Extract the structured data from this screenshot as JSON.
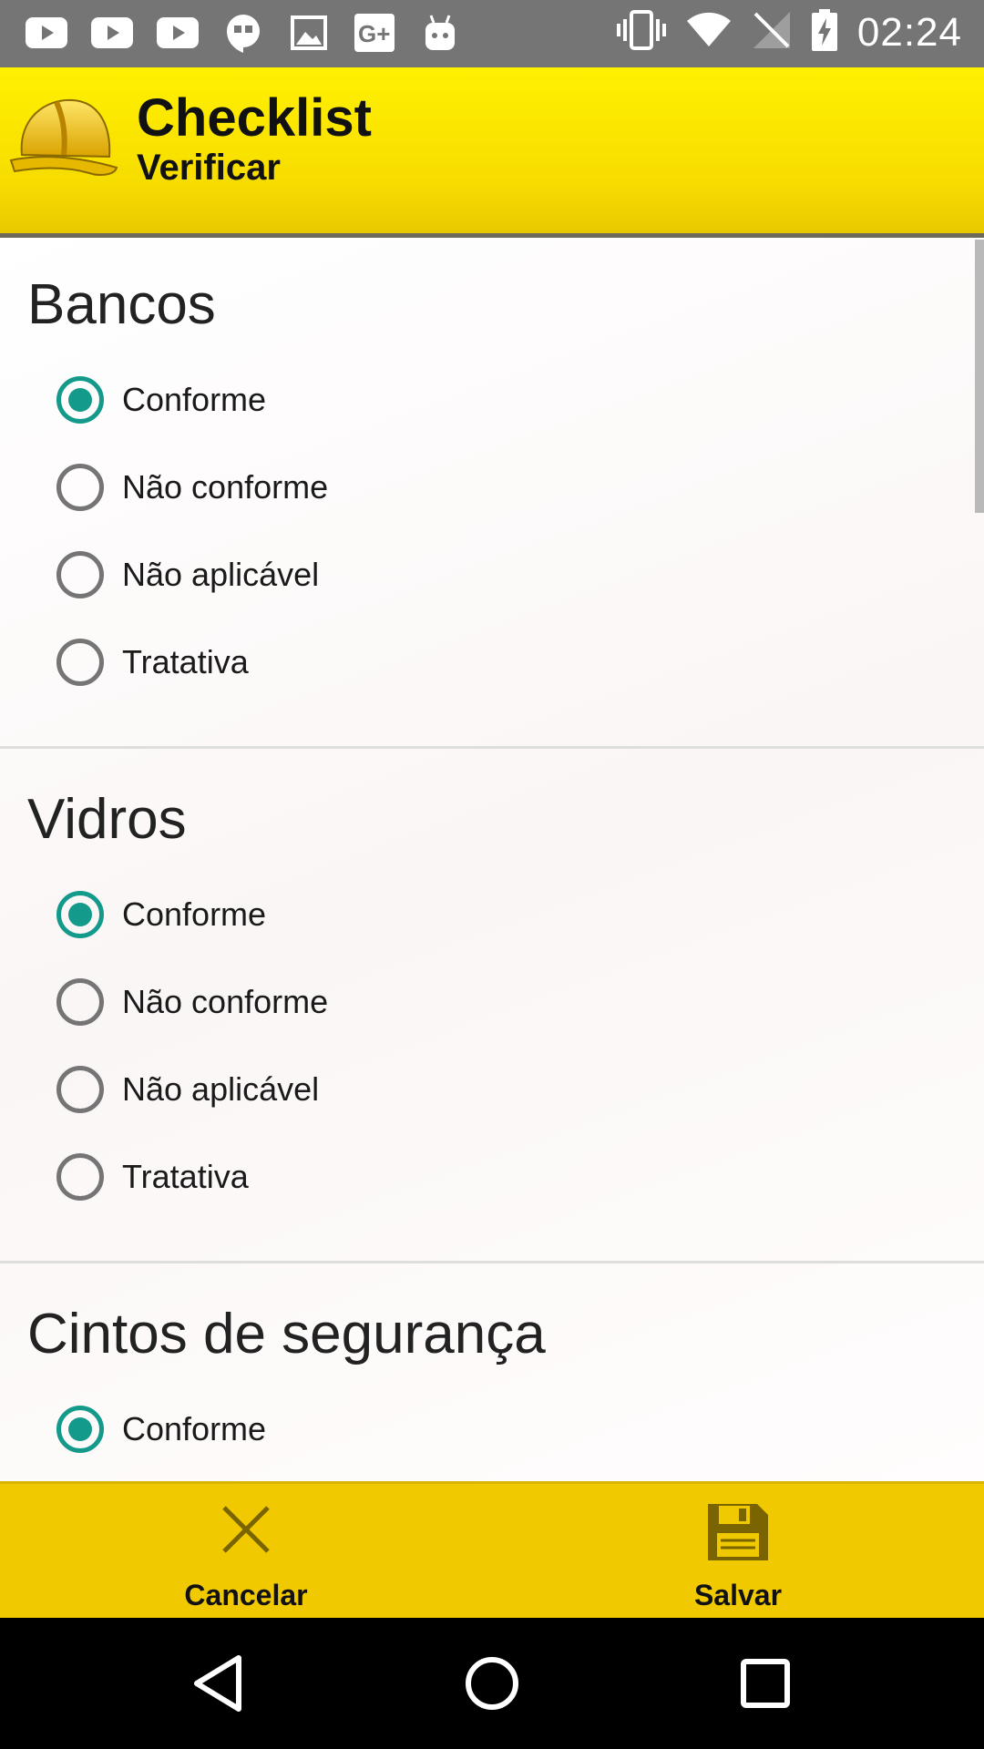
{
  "status_bar": {
    "time": "02:24",
    "notification_icons": [
      "youtube-icon",
      "youtube-icon",
      "youtube-icon",
      "hangouts-icon",
      "gallery-icon",
      "google-plus-icon",
      "android-icon"
    ],
    "system_icons": [
      "vibrate-icon",
      "wifi-icon",
      "no-signal-icon",
      "battery-charging-icon"
    ]
  },
  "header": {
    "title": "Checklist",
    "subtitle": "Verificar",
    "logo_icon": "hard-hat-icon"
  },
  "sections": [
    {
      "title": "Bancos",
      "options": [
        {
          "label": "Conforme",
          "checked": true
        },
        {
          "label": "Não conforme",
          "checked": false
        },
        {
          "label": "Não aplicável",
          "checked": false
        },
        {
          "label": "Tratativa",
          "checked": false
        }
      ]
    },
    {
      "title": "Vidros",
      "options": [
        {
          "label": "Conforme",
          "checked": true
        },
        {
          "label": "Não conforme",
          "checked": false
        },
        {
          "label": "Não aplicável",
          "checked": false
        },
        {
          "label": "Tratativa",
          "checked": false
        }
      ]
    },
    {
      "title": "Cintos de segurança",
      "options": [
        {
          "label": "Conforme",
          "checked": true
        }
      ]
    }
  ],
  "actions": {
    "cancel_label": "Cancelar",
    "save_label": "Salvar"
  },
  "colors": {
    "accent": "#139a8b",
    "header_yellow": "#fff100",
    "action_bar": "#f1c900",
    "status_bar": "#757575"
  }
}
